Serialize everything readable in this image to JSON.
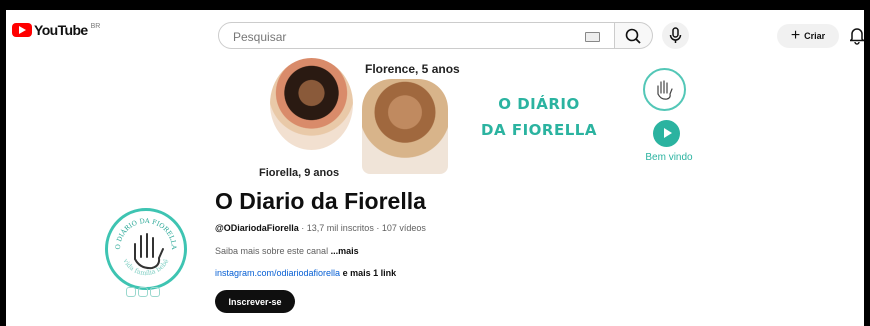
{
  "header": {
    "logo_text": "YouTube",
    "region": "BR",
    "search_placeholder": "Pesquisar",
    "create_label": "Criar"
  },
  "banner": {
    "caption_florence": "Florence, 5 anos",
    "caption_fiorella": "Fiorella, 9 anos",
    "brand_line1": "O DIÁRIO",
    "brand_line2": "DA FIORELLA",
    "welcome": "Bem vindo"
  },
  "channel": {
    "name": "O Diario da Fiorella",
    "handle": "@ODiariodaFiorella",
    "stats": " · 13,7 mil inscritos · 107 vídeos",
    "description": "Saiba mais sobre este canal ",
    "more": "...mais",
    "link_url": "instagram.com/odiariodafiorella",
    "link_extra": " e mais 1 link",
    "subscribe_label": "Inscrever-se",
    "avatar_ring_text": "O DIÁRIO DA FIORELLA",
    "avatar_bottom_text": "vida família bebê"
  },
  "colors": {
    "accent": "#2bb3a0",
    "youtube_red": "#ff0000",
    "link_blue": "#065fd4"
  }
}
